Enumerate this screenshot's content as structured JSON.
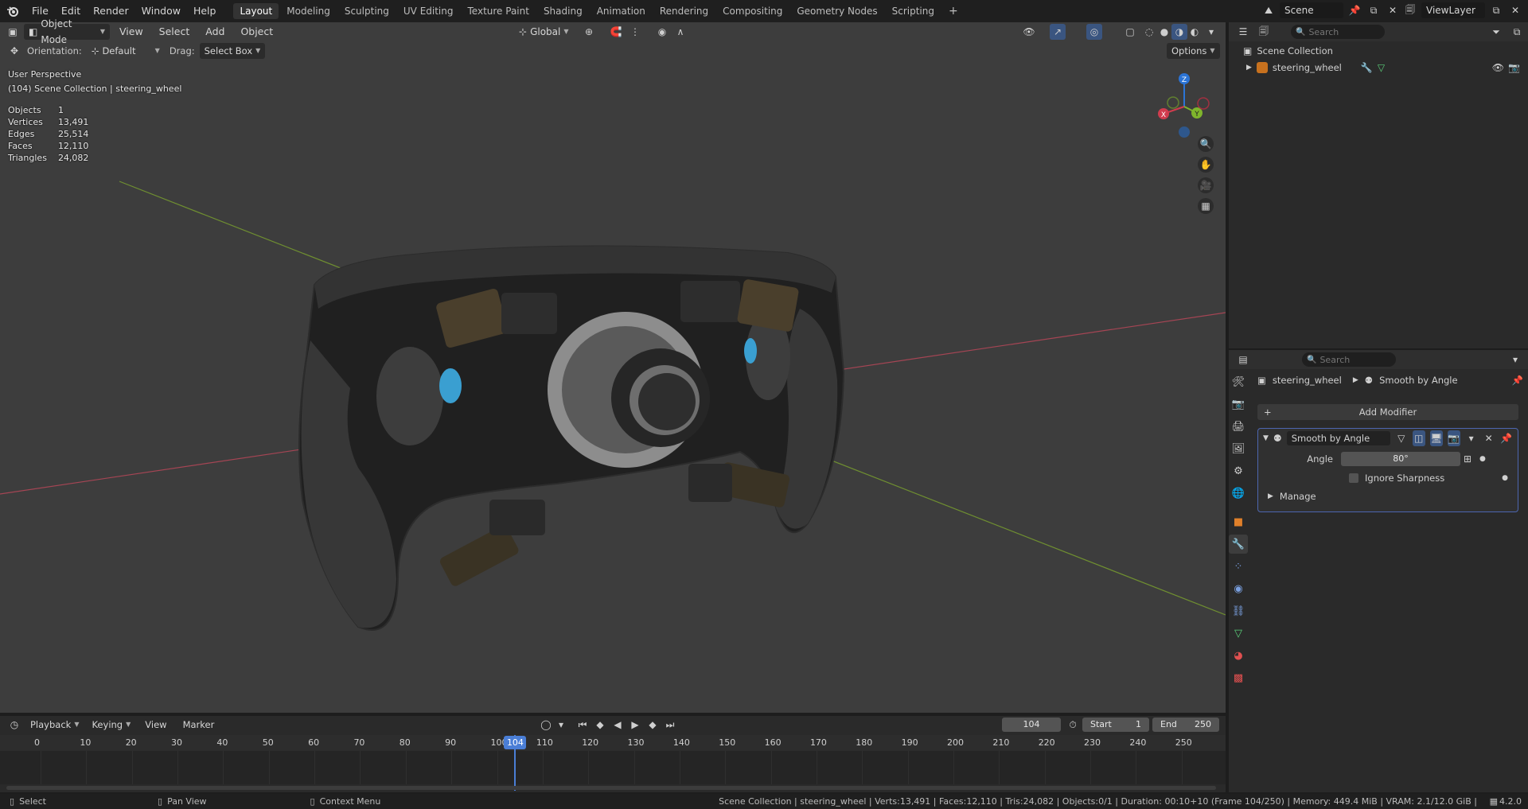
{
  "topbar": {
    "menus": [
      "File",
      "Edit",
      "Render",
      "Window",
      "Help"
    ],
    "workspaces": [
      "Layout",
      "Modeling",
      "Sculpting",
      "UV Editing",
      "Texture Paint",
      "Shading",
      "Animation",
      "Rendering",
      "Compositing",
      "Geometry Nodes",
      "Scripting"
    ],
    "active_workspace": "Layout",
    "add_workspace": "+",
    "scene_label": "Scene",
    "view_layer_label": "ViewLayer"
  },
  "viewport": {
    "mode": "Object Mode",
    "menus": [
      "View",
      "Select",
      "Add",
      "Object"
    ],
    "transform_orientation": "Global",
    "orientation_label": "Orientation:",
    "orientation_value": "Default",
    "drag_label": "Drag:",
    "drag_value": "Select Box",
    "options_label": "Options",
    "perspective_text": "User Perspective",
    "collection_text": "(104) Scene Collection | steering_wheel",
    "stats": [
      {
        "label": "Objects",
        "value": "1"
      },
      {
        "label": "Vertices",
        "value": "13,491"
      },
      {
        "label": "Edges",
        "value": "25,514"
      },
      {
        "label": "Faces",
        "value": "12,110"
      },
      {
        "label": "Triangles",
        "value": "24,082"
      }
    ],
    "gizmo_axes": {
      "x": "X",
      "y": "Y",
      "z": "Z"
    },
    "colors": {
      "x_axis": "#d03c4e",
      "y_axis": "#7fb52c",
      "z_axis": "#2b74d6",
      "background": "#3d3d3d"
    }
  },
  "outliner": {
    "search_placeholder": "Search",
    "scene_collection": "Scene Collection",
    "object_name": "steering_wheel"
  },
  "properties": {
    "search_placeholder": "Search",
    "breadcrumb_object": "steering_wheel",
    "breadcrumb_modifier": "Smooth by Angle",
    "add_modifier_label": "Add Modifier",
    "add_modifier_plus": "+",
    "modifier_name": "Smooth by Angle",
    "angle_label": "Angle",
    "angle_value": "80°",
    "ignore_sharpness_label": "Ignore Sharpness",
    "manage_label": "Manage"
  },
  "timeline": {
    "menus": [
      "Playback",
      "Keying",
      "View",
      "Marker"
    ],
    "current_frame": "104",
    "start_label": "Start",
    "start_value": "1",
    "end_label": "End",
    "end_value": "250",
    "ticks": [
      "0",
      "10",
      "20",
      "30",
      "40",
      "50",
      "60",
      "70",
      "80",
      "90",
      "100",
      "110",
      "120",
      "130",
      "140",
      "150",
      "160",
      "170",
      "180",
      "190",
      "200",
      "210",
      "220",
      "230",
      "240",
      "250"
    ],
    "playhead_label": "104"
  },
  "statusbar": {
    "select_label": "Select",
    "pan_label": "Pan View",
    "context_label": "Context Menu",
    "info": "Scene Collection | steering_wheel | Verts:13,491 | Faces:12,110 | Tris:24,082 | Objects:0/1 | Duration: 00:10+10 (Frame 104/250) | Memory: 449.4 MiB | VRAM: 2.1/12.0 GiB |",
    "version": "4.2.0"
  }
}
